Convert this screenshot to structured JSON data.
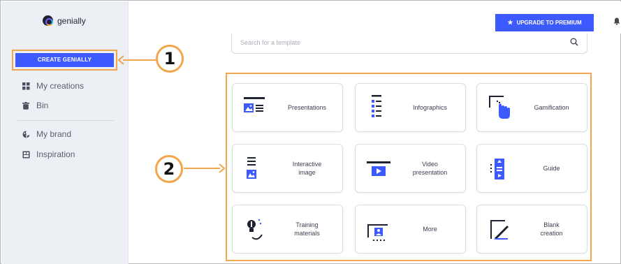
{
  "sidebar": {
    "logo_text": "genially",
    "create_button": "CREATE GENIALLY",
    "items": [
      {
        "label": "My creations",
        "icon": "grid-icon"
      },
      {
        "label": "Bin",
        "icon": "trash-icon"
      },
      {
        "label": "My brand",
        "icon": "palette-icon"
      },
      {
        "label": "Inspiration",
        "icon": "inspiration-icon"
      }
    ]
  },
  "topbar": {
    "upgrade_button": "UPGRADE TO PREMIUM"
  },
  "search": {
    "placeholder": "Search for a template"
  },
  "callouts": {
    "one": "1",
    "two": "2",
    "color": "#f2a54a"
  },
  "cards": [
    {
      "label": "Presentations",
      "icon": "presentation-icon"
    },
    {
      "label": "Infographics",
      "icon": "infographic-icon"
    },
    {
      "label": "Gamification",
      "icon": "gamification-icon"
    },
    {
      "label": "Interactive\nimage",
      "icon": "interactive-image-icon"
    },
    {
      "label": "Video\npresentation",
      "icon": "video-presentation-icon"
    },
    {
      "label": "Guide",
      "icon": "guide-icon"
    },
    {
      "label": "Training\nmaterials",
      "icon": "training-icon"
    },
    {
      "label": "More",
      "icon": "more-icon"
    },
    {
      "label": "Blank\ncreation",
      "icon": "blank-creation-icon"
    }
  ],
  "colors": {
    "accent": "#3d5afe",
    "sidebar_bg": "#eceff4",
    "icon_dark": "#1e2230",
    "highlight": "#f2a54a"
  }
}
